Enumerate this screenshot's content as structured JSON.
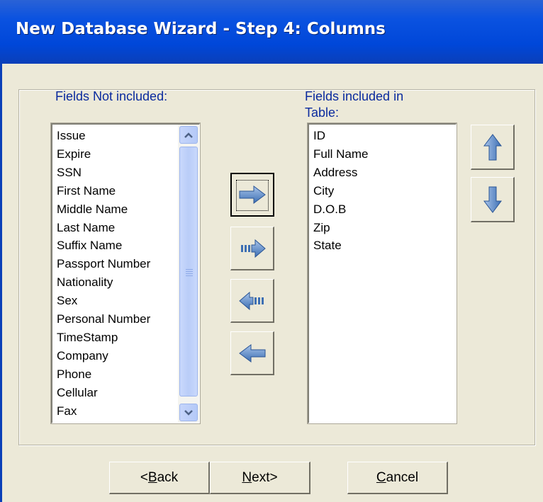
{
  "window": {
    "title": "New Database Wizard - Step 4: Columns"
  },
  "left_panel": {
    "label": "Fields Not included:",
    "items": [
      "Issue",
      "Expire",
      "SSN",
      "First Name",
      "Middle Name",
      "Last Name",
      "Suffix Name",
      "Passport Number",
      "Nationality",
      "Sex",
      "Personal Number",
      "TimeStamp",
      "Company",
      "Phone",
      "Cellular",
      "Fax"
    ]
  },
  "right_panel": {
    "label_line1": "Fields included in",
    "label_line2": "Table:",
    "items": [
      "ID",
      "Full Name",
      "Address",
      "City",
      "D.O.B",
      "Zip",
      "State"
    ]
  },
  "transfer_buttons": {
    "add_icon": "arrow-right-icon",
    "add_all_icon": "arrow-right-all-icon",
    "remove_all_icon": "arrow-left-all-icon",
    "remove_icon": "arrow-left-icon"
  },
  "order_buttons": {
    "up_icon": "arrow-up-icon",
    "down_icon": "arrow-down-icon"
  },
  "footer": {
    "back_label": "<Back",
    "back_mnemonic": "B",
    "next_label": "Next>",
    "next_mnemonic": "N",
    "cancel_label": "Cancel",
    "cancel_mnemonic": "C"
  },
  "colors": {
    "title_bar": "#0047d9",
    "window_bg": "#ece9d8",
    "label_text": "#0a2a9e",
    "arrow_fill": "#4a7ab8"
  }
}
